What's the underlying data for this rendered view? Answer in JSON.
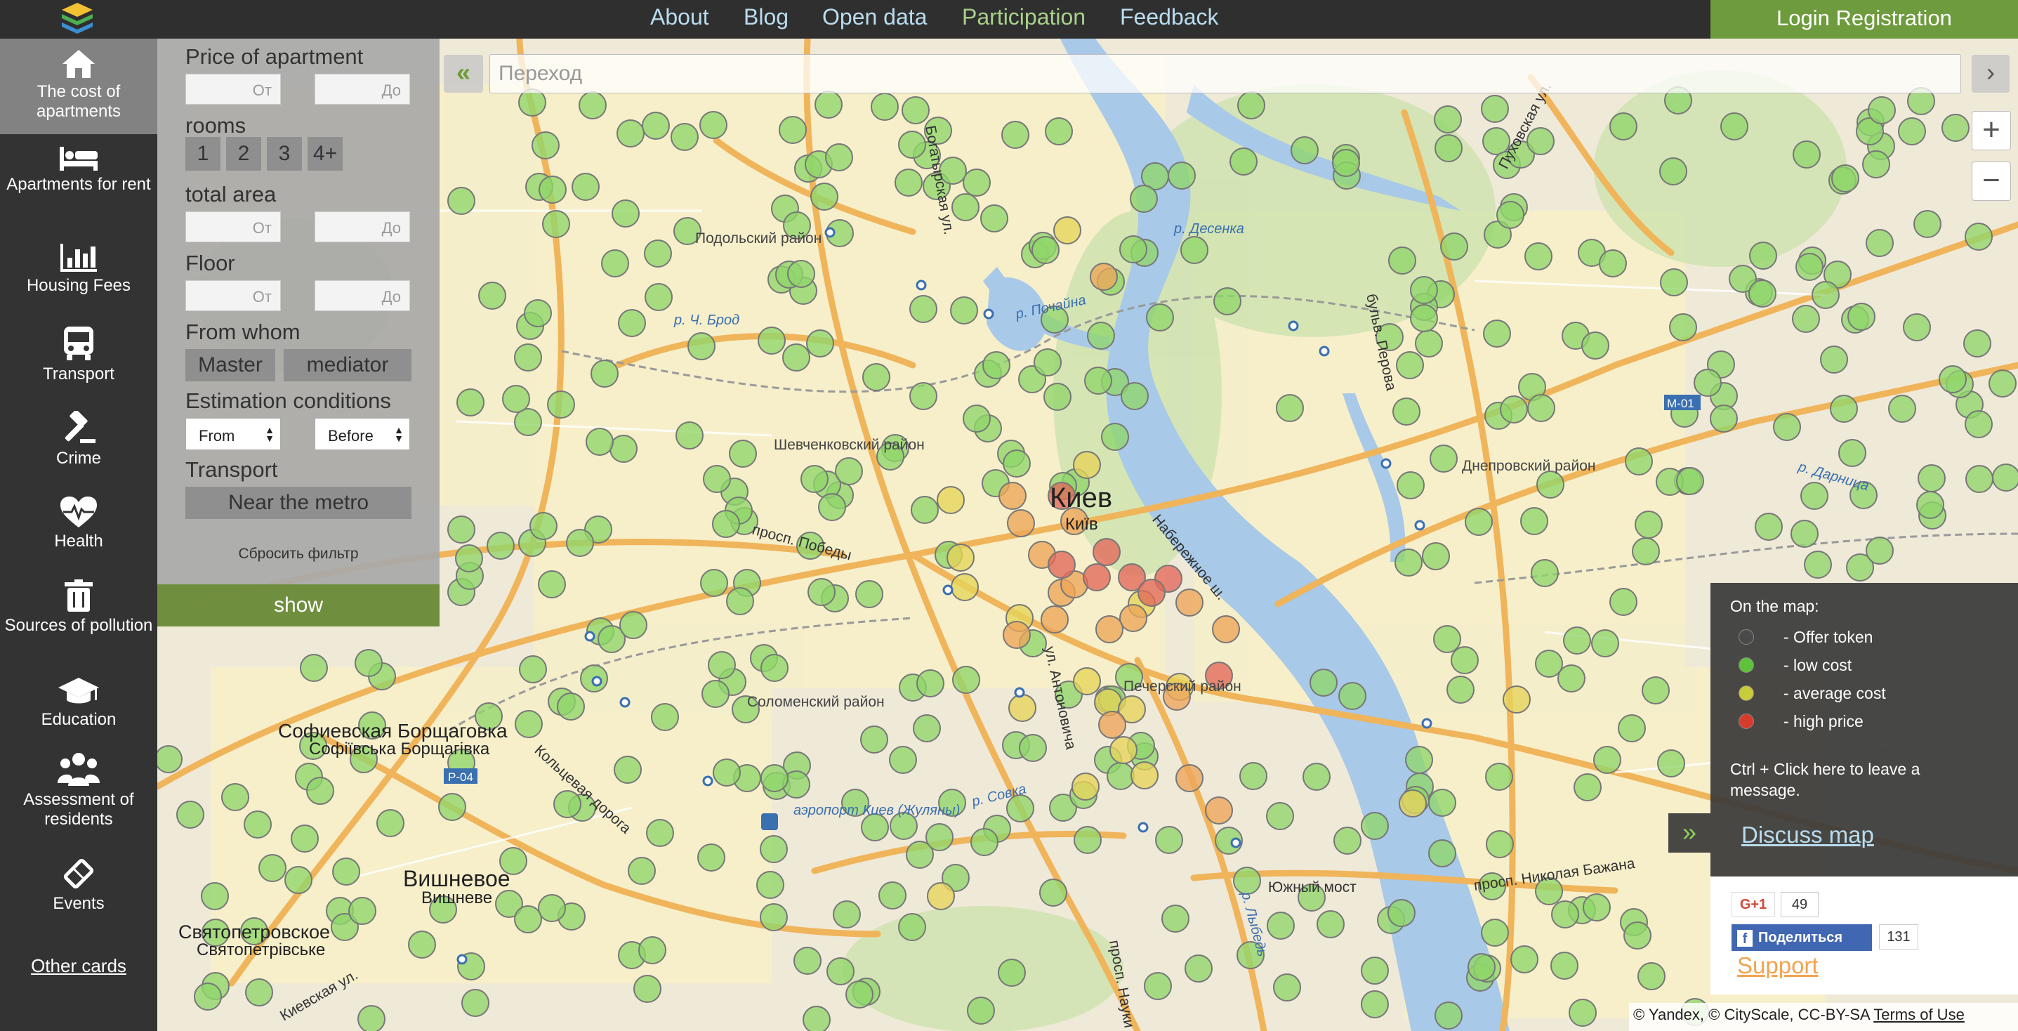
{
  "nav": {
    "links": [
      "About",
      "Blog",
      "Open data",
      "Participation",
      "Feedback"
    ],
    "login": "Login Registration"
  },
  "sidebar": {
    "items": [
      {
        "label": "The cost of apartments",
        "icon": "home-icon",
        "active": true
      },
      {
        "label": "Apartments for rent",
        "icon": "bed-icon"
      },
      {
        "label": "Housing Fees",
        "icon": "bar-chart-icon"
      },
      {
        "label": "Transport",
        "icon": "bus-icon"
      },
      {
        "label": "Crime",
        "icon": "gavel-icon"
      },
      {
        "label": "Health",
        "icon": "heartbeat-icon"
      },
      {
        "label": "Sources of pollution",
        "icon": "trash-icon"
      },
      {
        "label": "Education",
        "icon": "graduation-cap-icon"
      },
      {
        "label": "Assessment of residents",
        "icon": "users-icon"
      },
      {
        "label": "Events",
        "icon": "ticket-icon"
      }
    ],
    "other_cards": "Other cards"
  },
  "filters": {
    "price_label": "Price of apartment",
    "from_placeholder": "От",
    "to_placeholder": "До",
    "rooms_label": "rooms",
    "rooms": [
      "1",
      "2",
      "3",
      "4+"
    ],
    "area_label": "total area",
    "floor_label": "Floor",
    "from_whom_label": "From whom",
    "from_whom": [
      "Master",
      "mediator"
    ],
    "estimation_label": "Estimation conditions",
    "estimation_from": "From",
    "estimation_before": "Before",
    "transport_label": "Transport",
    "near_metro": "Near the metro",
    "reset": "Сбросить фильтр",
    "show": "show"
  },
  "map": {
    "search_placeholder": "Переход",
    "collapse": "«",
    "search_go": "›",
    "zoom_in": "+",
    "zoom_out": "−",
    "labels": {
      "city": "Киев",
      "city_ua": "Київ",
      "sofievskaya": "Софиевская Борщаговка",
      "sofievskaya_ua": "Софіївська Борщагівка",
      "vishnevoe": "Вишневое",
      "vishnevoe_ua": "Вишневе",
      "svyatopetrovskoe": "Святопетровское",
      "svyatopetrovskoe_ua": "Святопетрівське",
      "podolsky": "Подольский район",
      "shevchenkovsky": "Шевченковский район",
      "solomensky": "Соломенский район",
      "pechersky": "Печерский район",
      "dneprovsky": "Днепровский район",
      "airport": "аэропорт Киев (Жуляны)",
      "pobedy": "просп. Победы",
      "naberezhnoe": "Набережное ш.",
      "bogatyrskaya": "Богатырская ул.",
      "antonovicha": "ул. Антоновича",
      "kolcevaya": "Кольцевая дорога",
      "yuzhny_most": "Южный мост",
      "bazhana": "просп. Николая Бажана",
      "desenka": "р. Десенка",
      "pochayna": "р. Почайна",
      "lybid": "р. Лыбедь",
      "sovka": "р. Совка",
      "darnitsa": "р. Дарница",
      "puhovskaya": "Пуховская ул.",
      "perova": "бульв. Перова",
      "kievskaya": "Киевская ул.",
      "chbrod": "р. Ч. Брод",
      "nauki": "просп. Науки",
      "r04": "Р-04",
      "m01": "М-01"
    }
  },
  "legend": {
    "title": "On the map:",
    "items": [
      {
        "label": "- Offer token",
        "color": "#4a4a4a"
      },
      {
        "label": "- low cost",
        "color": "#5fc23a"
      },
      {
        "label": "- average cost",
        "color": "#c9cc3a"
      },
      {
        "label": "- high price",
        "color": "#d63c2c"
      }
    ],
    "hint": "Ctrl + Click here to leave a message.",
    "discuss": "Discuss map",
    "expand": "»"
  },
  "social": {
    "gplus": "G+1",
    "gplus_count": "49",
    "fb_share": "Поделиться",
    "fb_count": "131",
    "support": "Support"
  },
  "copyright": {
    "text": "© Yandex, © CityScale, CC-BY-SA",
    "terms": "Terms of Use"
  },
  "colors": {
    "low": "#8fd66a",
    "average": "#e6d45a",
    "mid_high": "#eda55a",
    "high": "#e2685a"
  }
}
